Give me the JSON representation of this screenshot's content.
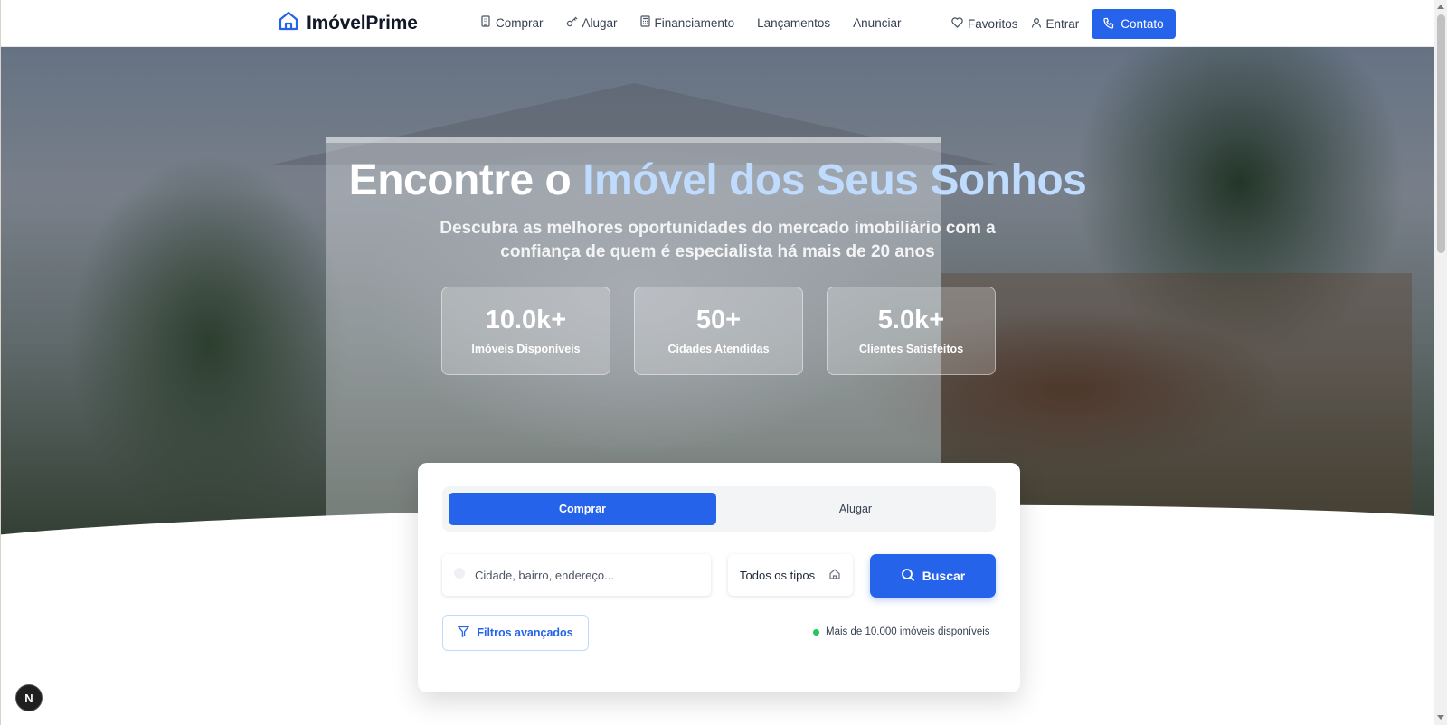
{
  "brand": {
    "name": "ImóvelPrime",
    "accent": "#2563eb"
  },
  "nav": [
    {
      "label": "Comprar",
      "icon": "building-icon"
    },
    {
      "label": "Alugar",
      "icon": "key-icon"
    },
    {
      "label": "Financiamento",
      "icon": "calculator-icon"
    },
    {
      "label": "Lançamentos",
      "icon": ""
    },
    {
      "label": "Anunciar",
      "icon": ""
    }
  ],
  "header_actions": {
    "favorites": "Favoritos",
    "login": "Entrar",
    "contact": "Contato"
  },
  "hero": {
    "title_prefix": "Encontre o",
    "title_accent": "Imóvel dos Seus Sonhos",
    "subtitle": "Descubra as melhores oportunidades do mercado imobiliário com a confiança de quem é especialista há mais de 20 anos",
    "stats": [
      {
        "value": "10.0k+",
        "label": "Imóveis Disponíveis"
      },
      {
        "value": "50+",
        "label": "Cidades Atendidas"
      },
      {
        "value": "5.0k+",
        "label": "Clientes Satisfeitos"
      }
    ]
  },
  "search": {
    "tabs": [
      {
        "label": "Comprar",
        "active": true
      },
      {
        "label": "Alugar",
        "active": false
      }
    ],
    "placeholder": "Cidade, bairro, endereço...",
    "value": "",
    "type_select": "Todos os tipos",
    "submit_label": "Buscar",
    "filters_label": "Filtros avançados",
    "availability": "Mais de 10.000 imóveis disponíveis"
  },
  "dev_badge": "N"
}
